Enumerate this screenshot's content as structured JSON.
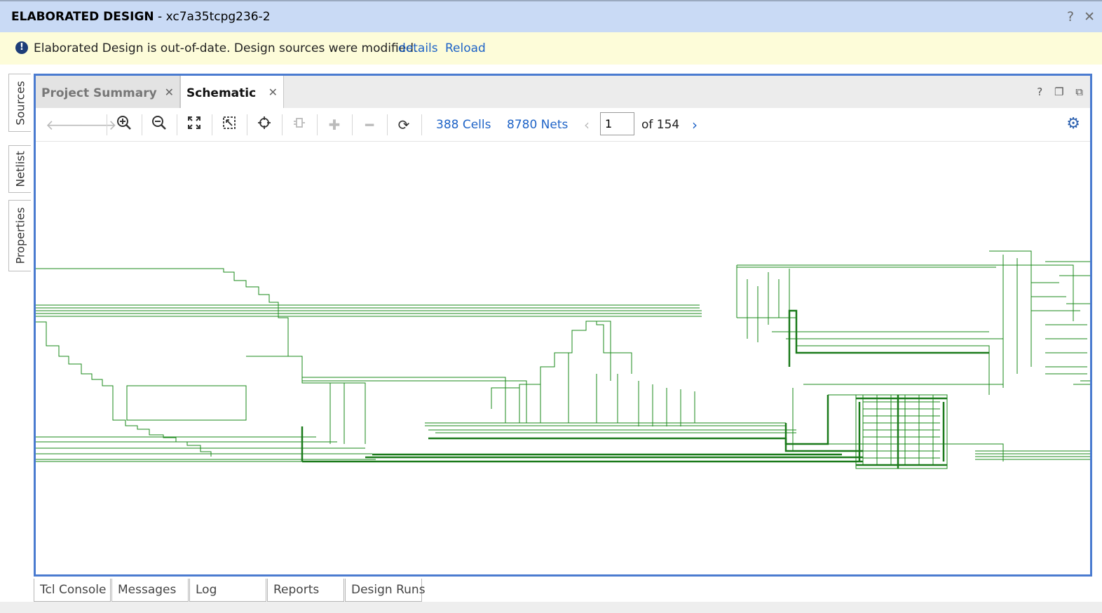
{
  "window": {
    "title_bold": "ELABORATED DESIGN",
    "title_rest": " - xc7a35tcpg236-2",
    "help_glyph": "?",
    "close_glyph": "✕"
  },
  "banner": {
    "message": "Elaborated Design is out-of-date. Design sources were modified.",
    "details_label": "details",
    "reload_label": "Reload",
    "icon": "exclamation-circle-icon"
  },
  "side_tabs": [
    {
      "label": "Sources"
    },
    {
      "label": "Netlist"
    },
    {
      "label": "Properties"
    }
  ],
  "tabs": [
    {
      "label": "Project Summary",
      "active": false
    },
    {
      "label": "Schematic",
      "active": true
    }
  ],
  "toolbar": {
    "cells_label": "388 Cells",
    "nets_label": "8780 Nets",
    "page_value": "1",
    "of_label": "of 154"
  },
  "bottom_tabs": [
    {
      "label": "Tcl Console"
    },
    {
      "label": "Messages"
    },
    {
      "label": "Log"
    },
    {
      "label": "Reports"
    },
    {
      "label": "Design Runs"
    }
  ],
  "colors": {
    "accent_blue": "#4a7bd0",
    "link_blue": "#1e63c7",
    "schematic_green": "#1a8a1a",
    "banner_bg": "#fdfcd9",
    "title_bg": "#c9daf5"
  }
}
